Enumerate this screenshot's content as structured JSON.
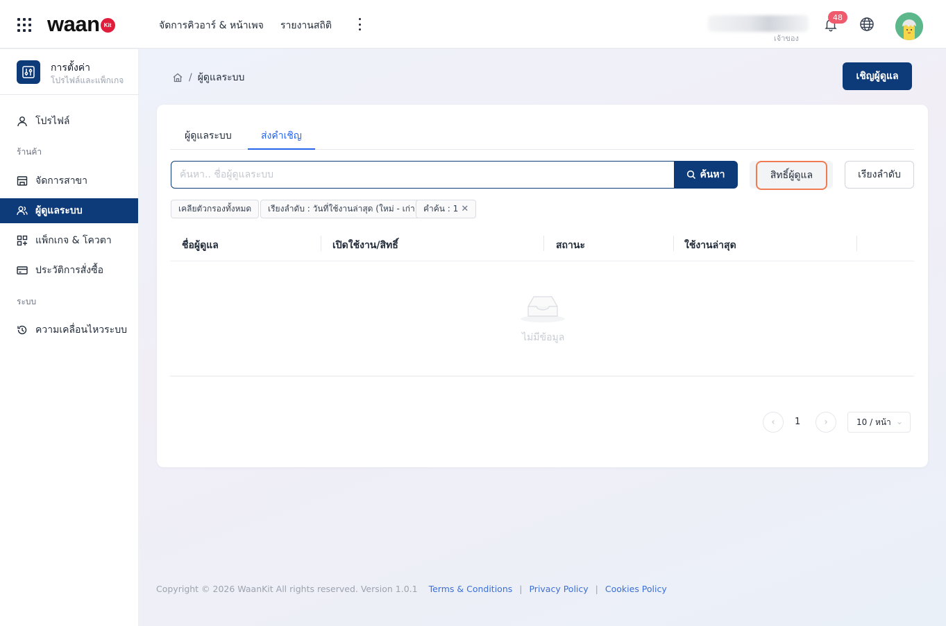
{
  "header": {
    "logo_text": "waan",
    "logo_badge": "Kit",
    "nav": [
      "จัดการคิวอาร์ & หน้าเพจ",
      "รายงานสถิติ"
    ],
    "user_role": "เจ้าของ",
    "notification_count": "48"
  },
  "sidebar": {
    "title": "การตั้งค่า",
    "subtitle": "โปรไฟล์และแพ็กเกจ",
    "profile": "โปรไฟล์",
    "section_store": "ร้านค้า",
    "branches": "จัดการสาขา",
    "admins": "ผู้ดูแลระบบ",
    "packages": "แพ็กเกจ & โควตา",
    "orders": "ประวัติการสั่งซื้อ",
    "section_system": "ระบบ",
    "activity": "ความเคลื่อนไหวระบบ"
  },
  "breadcrumb": {
    "separator": "/",
    "current": "ผู้ดูแลระบบ"
  },
  "invite_button": "เชิญผู้ดูแล",
  "tabs": [
    "ผู้ดูแลระบบ",
    "ส่งคำเชิญ"
  ],
  "search": {
    "placeholder": "ค้นหา.. ชื่อผู้ดูแลระบบ",
    "button": "ค้นหา"
  },
  "permission_button": "สิทธิ์ผู้ดูแล",
  "sort_button": "เรียงลำดับ",
  "filters": {
    "clear": "เคลียตัวกรองทั้งหมด",
    "sort": "เรียงลำดับ : วันที่ใช้งานล่าสุด (ใหม่ - เก่า)",
    "keyword": "คำค้น : 1"
  },
  "table": {
    "columns": [
      "ชื่อผู้ดูแล",
      "เปิดใช้งาน/สิทธิ์",
      "สถานะ",
      "ใช้งานล่าสุด"
    ],
    "rows": [],
    "empty_text": "ไม่มีข้อมูล"
  },
  "pagination": {
    "current": "1",
    "page_size": "10 / หน้า"
  },
  "footer": {
    "copyright": "Copyright © 2026 WaanKit All rights reserved. Version 1.0.1",
    "links": [
      "Terms & Conditions",
      "Privacy Policy",
      "Cookies Policy"
    ],
    "separator": "|"
  },
  "colors": {
    "primary": "#0d3a78",
    "accent_tab": "#2563eb",
    "badge": "#f05a6d",
    "highlight": "#f07b52"
  }
}
